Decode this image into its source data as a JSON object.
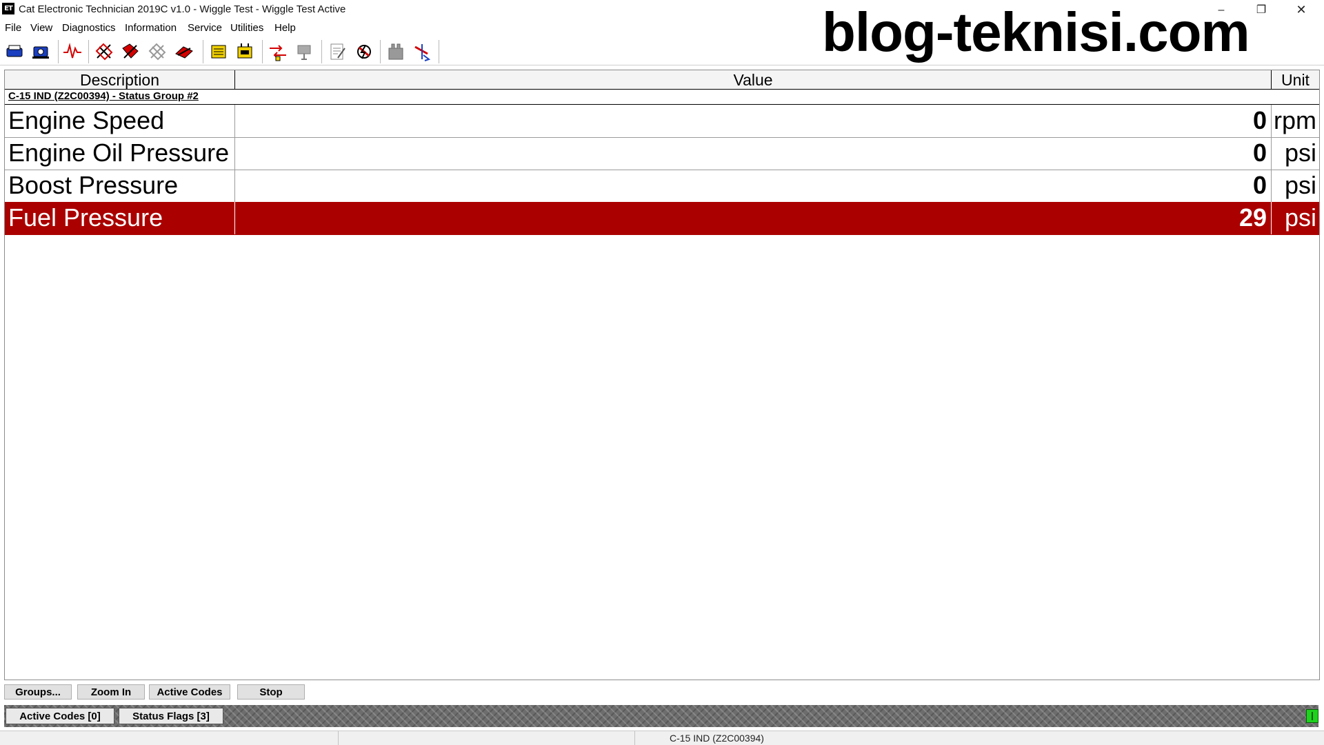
{
  "window": {
    "app_icon_label": "ET",
    "title": "Cat Electronic Technician 2019C v1.0 - Wiggle Test - Wiggle Test Active",
    "minimize": "–",
    "maximize": "❐",
    "close": "✕"
  },
  "watermark": "blog-teknisi.com",
  "menu": {
    "items": [
      "File",
      "View",
      "Diagnostics",
      "Information",
      "Service",
      "Utilities",
      "Help"
    ]
  },
  "toolbar": {
    "icons": [
      "connect-icon",
      "ecm-summary-icon",
      "waveform-icon",
      "diagnostic-codes-icon",
      "event-codes-icon",
      "logged-codes-icon",
      "clear-codes-icon",
      "configuration-icon",
      "status-icon",
      "wiggle-test-icon",
      "cylinder-cutout-icon",
      "calibration-icon",
      "flash-icon",
      "product-link-icon",
      "injector-icon"
    ],
    "colors": {
      "accent_yellow": "#f0d000",
      "accent_red": "#d40000",
      "accent_blue": "#1a3fc0"
    }
  },
  "table": {
    "headers": {
      "description": "Description",
      "value": "Value",
      "unit": "Unit"
    },
    "group_label": "C-15 IND (Z2C00394) - Status Group #2",
    "rows": [
      {
        "description": "Engine Speed",
        "value": "0",
        "unit": "rpm",
        "alert": false
      },
      {
        "description": "Engine Oil Pressure",
        "value": "0",
        "unit": "psi",
        "alert": false
      },
      {
        "description": "Boost Pressure",
        "value": "0",
        "unit": "psi",
        "alert": false
      },
      {
        "description": "Fuel Pressure",
        "value": "29",
        "unit": "psi",
        "alert": true
      }
    ],
    "alert_color": "#aa0000"
  },
  "buttons": {
    "groups": "Groups...",
    "zoom_in": "Zoom In",
    "active_codes": "Active Codes",
    "stop": "Stop"
  },
  "status_strip": {
    "active_codes": "Active Codes [0]",
    "status_flags": "Status Flags [3]",
    "led_color": "#1ed21e"
  },
  "statusbar": {
    "ecm": "C-15 IND (Z2C00394)"
  }
}
